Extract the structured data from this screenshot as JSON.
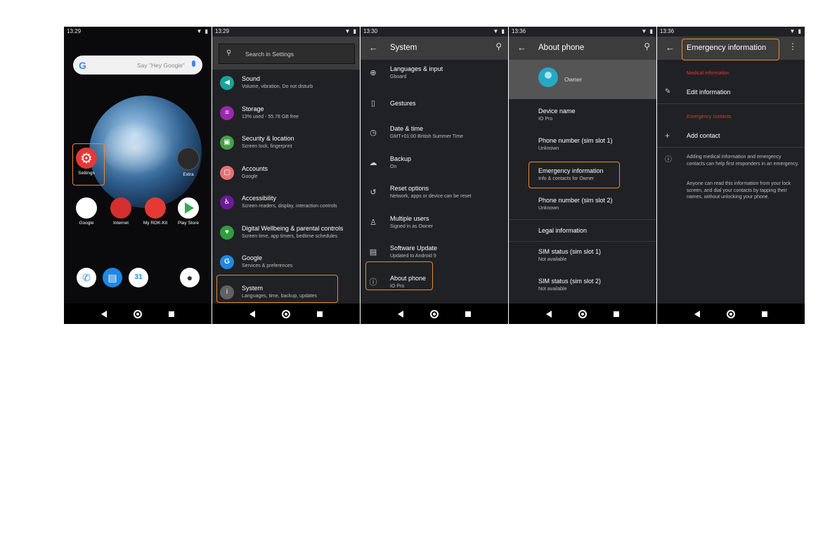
{
  "screen1": {
    "time": "13:29",
    "search_hint": "Say \"Hey Google\"",
    "apps": [
      "Settings",
      "Google",
      "Internet",
      "My ROK-Kit",
      "Play Store",
      "Extra"
    ],
    "google_logo": "G"
  },
  "screen2": {
    "time": "13:29",
    "search_placeholder": "Search in Settings",
    "items": [
      {
        "title": "Sound",
        "subtitle": "Volume, vibration, Do not disturb",
        "color": "#1aa39a",
        "icon": "speaker-icon"
      },
      {
        "title": "Storage",
        "subtitle": "13% used - 55.78 GB free",
        "color": "#9c27b0",
        "icon": "storage-icon"
      },
      {
        "title": "Security & location",
        "subtitle": "Screen lock, fingerprint",
        "color": "#43a047",
        "icon": "lock-icon"
      },
      {
        "title": "Accounts",
        "subtitle": "Google",
        "color": "#e57373",
        "icon": "account-icon"
      },
      {
        "title": "Accessibility",
        "subtitle": "Screen readers, display, interaction controls",
        "color": "#6a1b9a",
        "icon": "accessibility-icon"
      },
      {
        "title": "Digital Wellbeing & parental controls",
        "subtitle": "Screen time, app timers, bedtime schedules",
        "color": "#2e9e3e",
        "icon": "wellbeing-icon"
      },
      {
        "title": "Google",
        "subtitle": "Services & preferences",
        "color": "#1e88e5",
        "icon": "google-icon"
      },
      {
        "title": "System",
        "subtitle": "Languages, time, backup, updates",
        "color": "#616161",
        "icon": "info-icon"
      }
    ]
  },
  "screen3": {
    "time": "13:30",
    "title": "System",
    "items": [
      {
        "title": "Languages & input",
        "subtitle": "Gboard",
        "icon": "globe-icon"
      },
      {
        "title": "Gestures",
        "subtitle": "",
        "icon": "gestures-icon"
      },
      {
        "title": "Date & time",
        "subtitle": "GMT+01:00 British Summer Time",
        "icon": "clock-icon"
      },
      {
        "title": "Backup",
        "subtitle": "On",
        "icon": "backup-icon"
      },
      {
        "title": "Reset options",
        "subtitle": "Network, apps or device can be reset",
        "icon": "history-icon"
      },
      {
        "title": "Multiple users",
        "subtitle": "Signed in as Owner",
        "icon": "person-icon"
      },
      {
        "title": "Software Update",
        "subtitle": "Updated to Android 9",
        "icon": "update-icon"
      },
      {
        "title": "About phone",
        "subtitle": "IO Pro",
        "icon": "info-icon"
      }
    ]
  },
  "screen4": {
    "time": "13:36",
    "title": "About phone",
    "owner": "Owner",
    "items": [
      {
        "title": "Device name",
        "subtitle": "IO Pro"
      },
      {
        "title": "Phone number (sim slot 1)",
        "subtitle": "Unknown"
      },
      {
        "title": "Emergency information",
        "subtitle": "Info & contacts for Owner"
      },
      {
        "title": "Phone number (sim slot 2)",
        "subtitle": "Unknown"
      },
      {
        "title": "Legal information",
        "subtitle": ""
      },
      {
        "title": "SIM status (sim slot 1)",
        "subtitle": "Not available"
      },
      {
        "title": "SIM status (sim slot 2)",
        "subtitle": "Not available"
      }
    ]
  },
  "screen5": {
    "time": "13:36",
    "title": "Emergency information",
    "medical_header": "Medical information",
    "edit_label": "Edit information",
    "contacts_header": "Emergency contacts",
    "add_contact_label": "Add contact",
    "info_para1": "Adding medical information and emergency contacts can help first responders in an emergency.",
    "info_para2": "Anyone can read this information from your lock screen, and dial your contacts by tapping their names, without unlocking your phone."
  },
  "colors": {
    "highlight": "#e8892c",
    "accent_red": "#e53935",
    "background": "#202124"
  }
}
